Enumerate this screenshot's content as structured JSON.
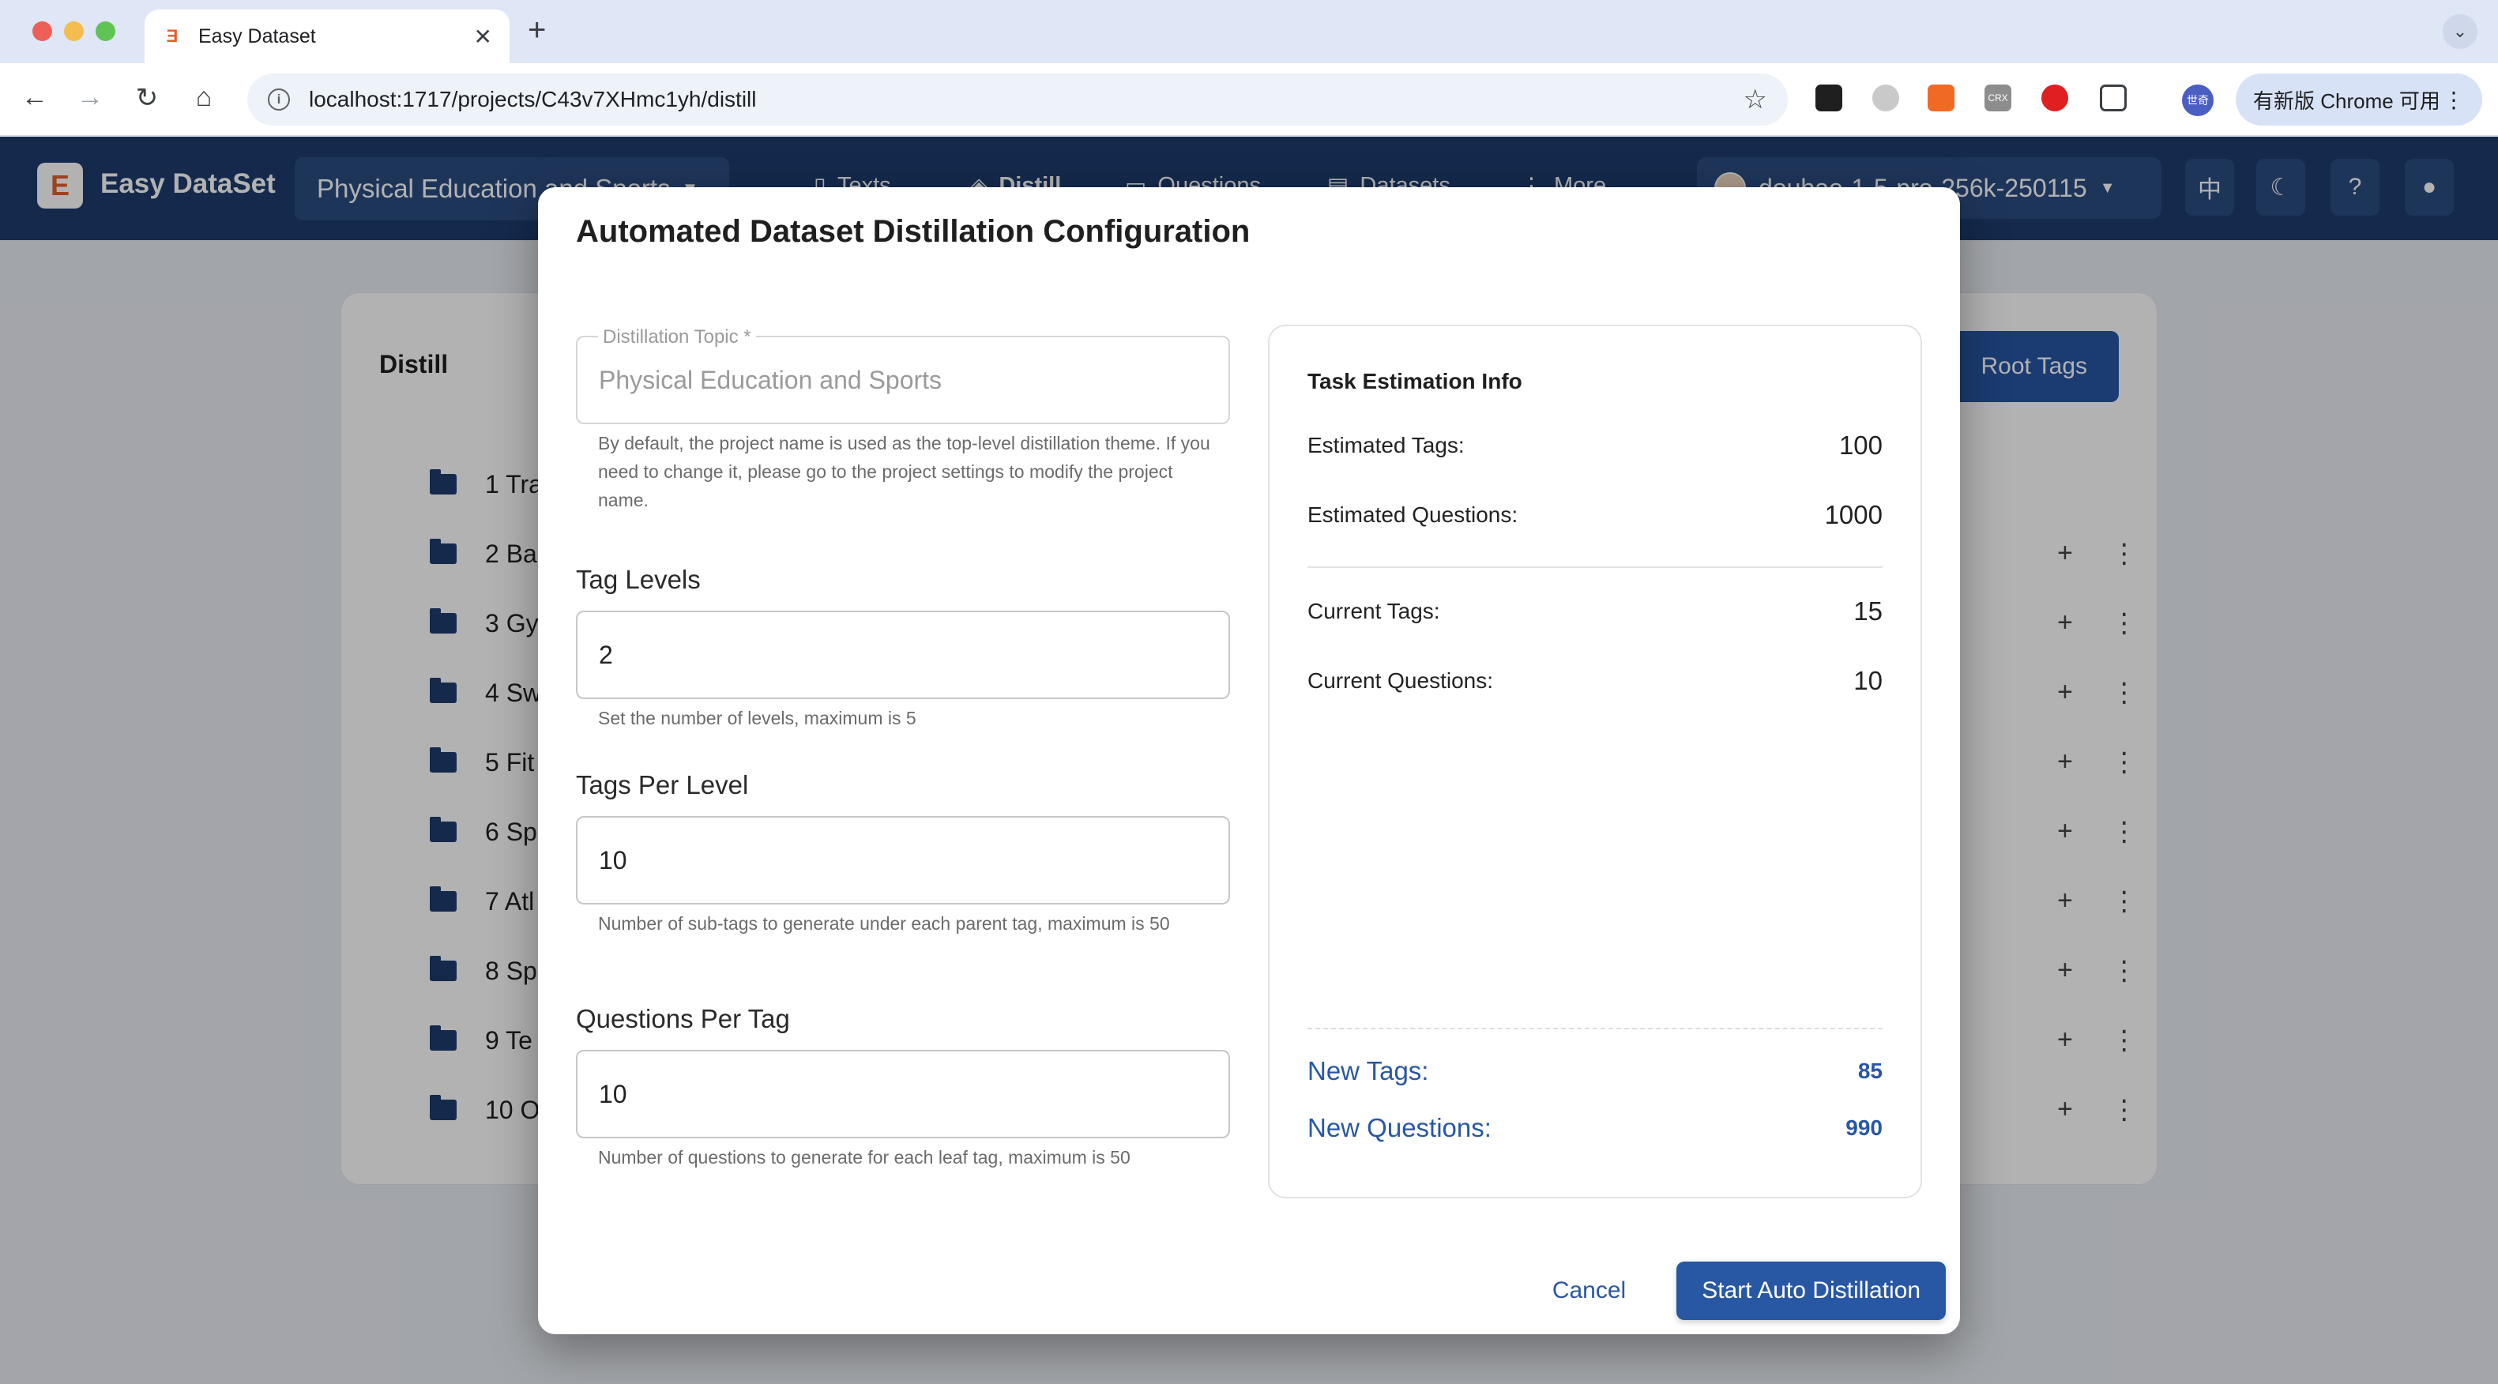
{
  "browser": {
    "tab_title": "Easy Dataset",
    "tab_favicon": "easy-dataset-logo",
    "url": "localhost:1717/projects/C43v7XHmc1yh/distill",
    "chrome_update_label": "有新版 Chrome 可用",
    "profile_label": "世奇",
    "ext_crx_label": "CRX"
  },
  "app": {
    "name": "Easy DataSet",
    "logo_char": "E",
    "project_name": "Physical Education and Sports",
    "nav": [
      {
        "label": "Texts",
        "icon": "document-icon"
      },
      {
        "label": "Distill",
        "icon": "cube-icon"
      },
      {
        "label": "Questions",
        "icon": "question-box-icon"
      },
      {
        "label": "Datasets",
        "icon": "dataset-icon"
      },
      {
        "label": "More",
        "icon": "more-vertical-icon"
      }
    ],
    "model": "doubao-1-5-pro-256k-250115",
    "lang_button": "中"
  },
  "page": {
    "title": "Distill",
    "root_tags_button": "Root Tags",
    "tree_items": [
      "1 Tra",
      "2 Ba",
      "3 Gy",
      "4 Sw",
      "5 Fit",
      "6 Sp",
      "7 Atl",
      "8 Sp",
      "9 Te",
      "10 O"
    ]
  },
  "dialog": {
    "title": "Automated Dataset Distillation Configuration",
    "topic_label": "Distillation Topic *",
    "topic_value": "Physical Education and Sports",
    "topic_helper": "By default, the project name is used as the top-level distillation theme. If you need to change it, please go to the project settings to modify the project name.",
    "tag_levels_label": "Tag Levels",
    "tag_levels_value": "2",
    "tag_levels_helper": "Set the number of levels, maximum is 5",
    "tags_per_level_label": "Tags Per Level",
    "tags_per_level_value": "10",
    "tags_per_level_helper": "Number of sub-tags to generate under each parent tag, maximum is 50",
    "questions_per_tag_label": "Questions Per Tag",
    "questions_per_tag_value": "10",
    "questions_per_tag_helper": "Number of questions to generate for each leaf tag, maximum is 50",
    "estimation": {
      "title": "Task Estimation Info",
      "estimated_tags_label": "Estimated Tags:",
      "estimated_tags_value": "100",
      "estimated_questions_label": "Estimated Questions:",
      "estimated_questions_value": "1000",
      "current_tags_label": "Current Tags:",
      "current_tags_value": "15",
      "current_questions_label": "Current Questions:",
      "current_questions_value": "10",
      "new_tags_label": "New Tags:",
      "new_tags_value": "85",
      "new_questions_label": "New Questions:",
      "new_questions_value": "990"
    },
    "cancel_label": "Cancel",
    "start_label": "Start Auto Distillation"
  },
  "colors": {
    "header_bg": "#1e3c6e",
    "primary": "#2857a4",
    "browser_chrome": "#dfe6f5"
  }
}
